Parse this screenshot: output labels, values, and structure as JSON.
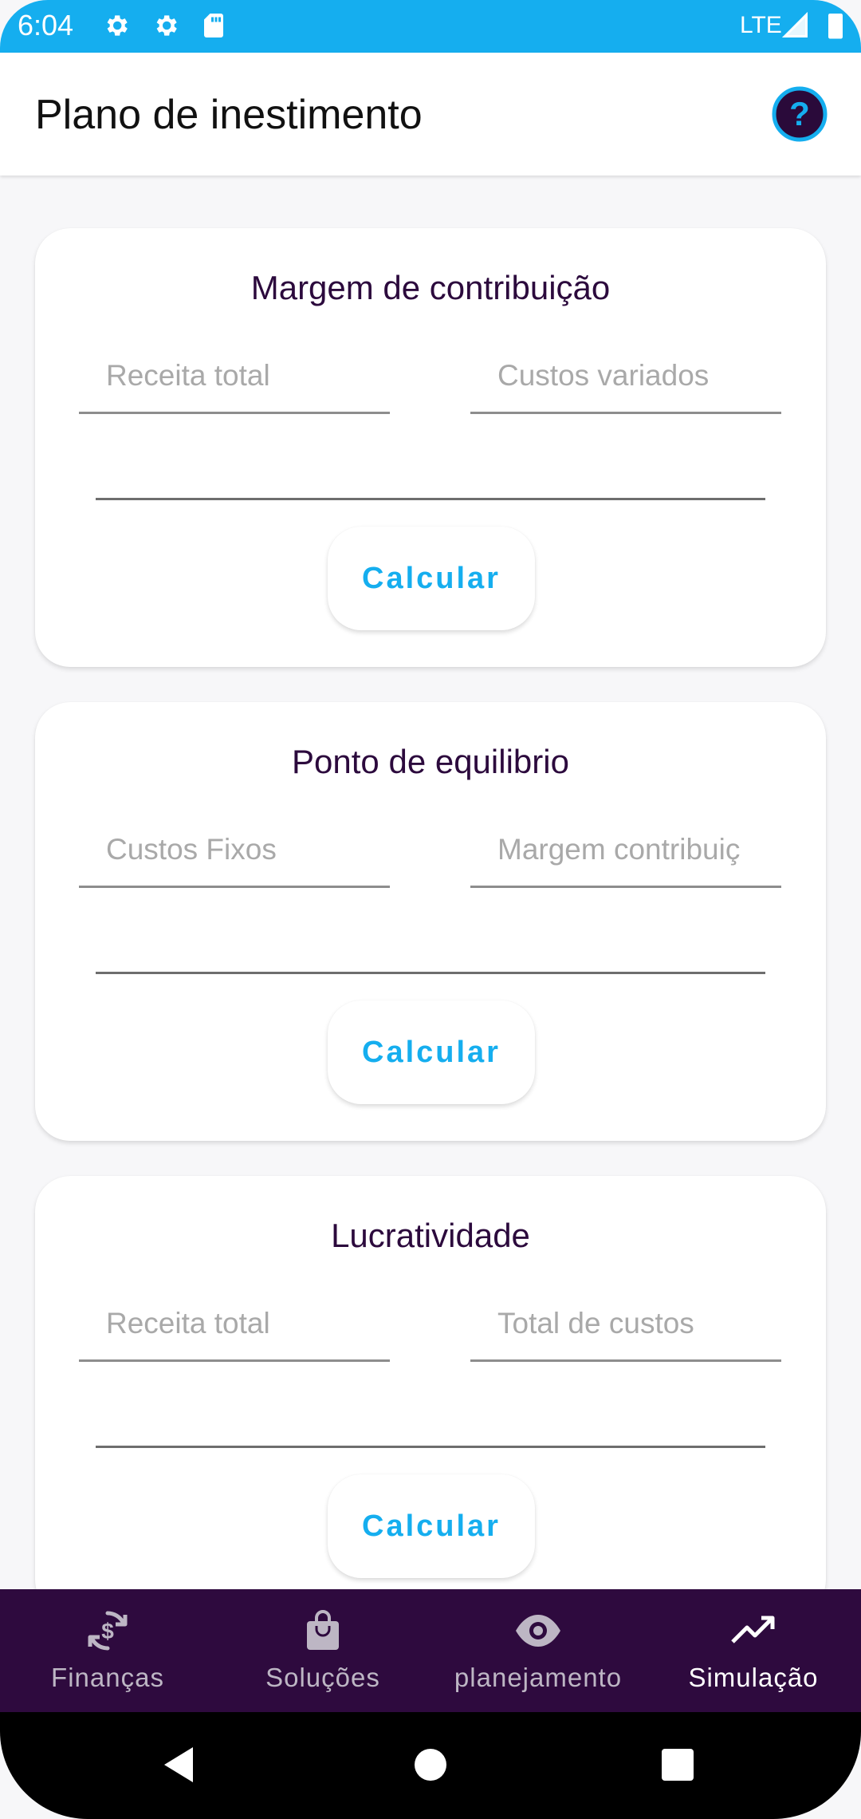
{
  "status_bar": {
    "time": "6:04",
    "network": "LTE",
    "icons": [
      "settings-icon",
      "settings-icon",
      "sd-card-icon",
      "signal-icon",
      "battery-icon"
    ]
  },
  "app_bar": {
    "title": "Plano de inestimento",
    "help_icon": "help-icon"
  },
  "cards": [
    {
      "title": "Margem de contribuição",
      "field1_placeholder": "Receita total",
      "field2_placeholder": "Custos variados",
      "button": "Calcular"
    },
    {
      "title": "Ponto de equilibrio",
      "field1_placeholder": "Custos Fixos",
      "field2_placeholder": "Margem contribuiç",
      "button": "Calcular"
    },
    {
      "title": "Lucratividade",
      "field1_placeholder": "Receita total",
      "field2_placeholder": "Total de custos",
      "button": "Calcular"
    }
  ],
  "bottom_nav": {
    "items": [
      {
        "label": "Finanças",
        "icon": "currency-exchange-icon",
        "active": false
      },
      {
        "label": "Soluções",
        "icon": "shopping-bag-icon",
        "active": false
      },
      {
        "label": "planejamento",
        "icon": "eye-icon",
        "active": false
      },
      {
        "label": "Simulação",
        "icon": "trending-up-icon",
        "active": true
      }
    ]
  },
  "colors": {
    "accent": "#15aeef",
    "nav_background": "#2e0a3e",
    "card_title": "#2c0a3d"
  }
}
